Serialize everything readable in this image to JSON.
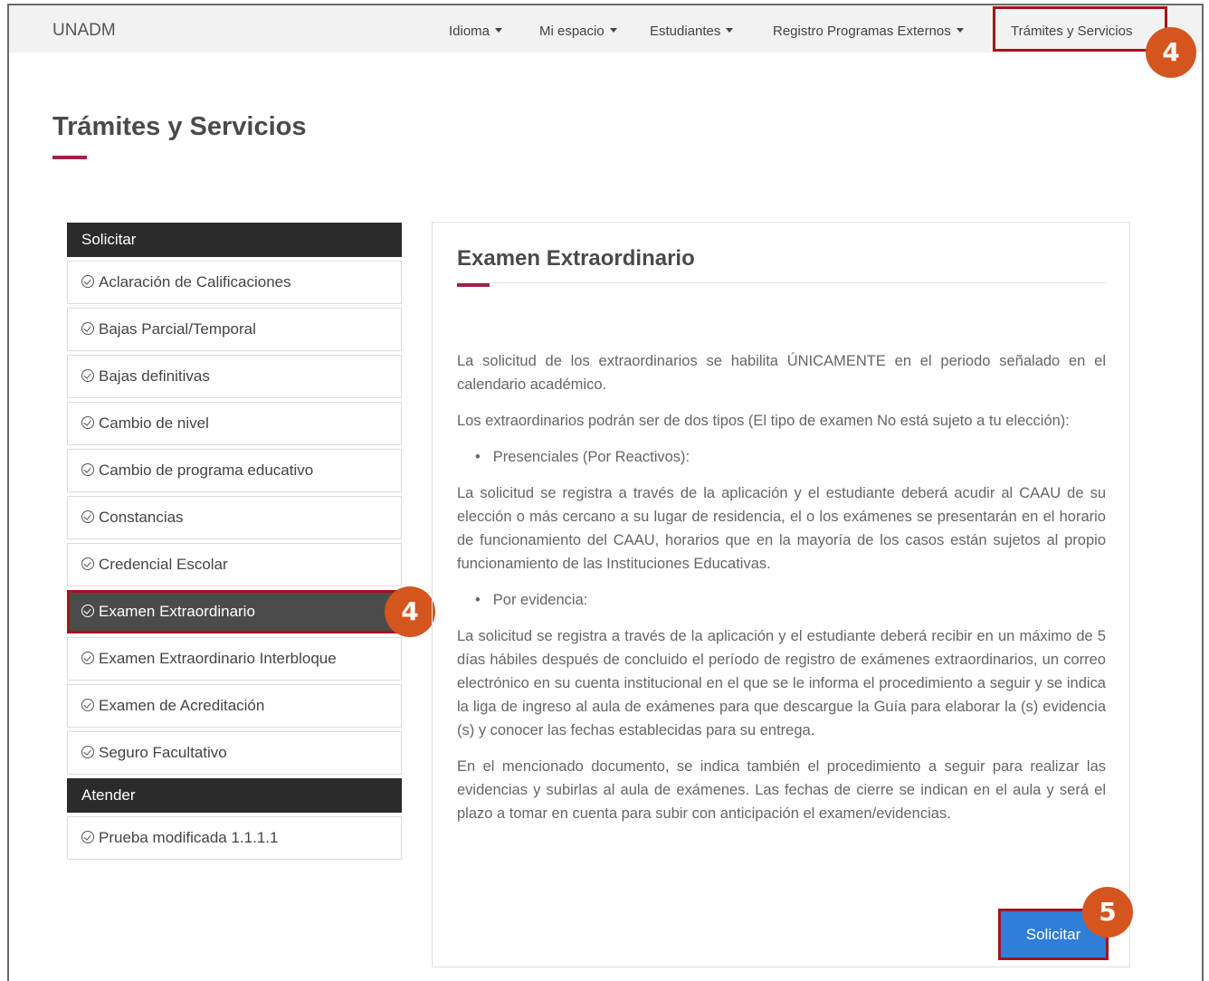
{
  "navbar": {
    "brand": "UNADM",
    "items": [
      {
        "label": "Idioma",
        "caret": true
      },
      {
        "label": "Mi espacio",
        "caret": true
      },
      {
        "label": "Estudiantes",
        "caret": true
      },
      {
        "label": "Registro Programas Externos",
        "caret": true
      },
      {
        "label": "Trámites y Servicios",
        "caret": false
      }
    ]
  },
  "annotations": {
    "nav_step": "4",
    "sidebar_step": "4",
    "button_step": "5",
    "color": "#d4551e",
    "highlight_color": "#a3151c"
  },
  "page": {
    "title": "Trámites y Servicios",
    "accent_color": "#9d2449"
  },
  "sidebar": {
    "section1": "Solicitar",
    "items": [
      {
        "label": "Aclaración de Calificaciones",
        "icon": "check-circle-icon"
      },
      {
        "label": "Bajas Parcial/Temporal",
        "icon": "check-circle-icon"
      },
      {
        "label": "Bajas definitivas",
        "icon": "check-circle-icon"
      },
      {
        "label": "Cambio de nivel",
        "icon": "check-circle-icon"
      },
      {
        "label": "Cambio de programa educativo",
        "icon": "check-circle-icon"
      },
      {
        "label": "Constancias",
        "icon": "check-circle-icon"
      },
      {
        "label": "Credencial Escolar",
        "icon": "check-circle-icon"
      },
      {
        "label": "Examen Extraordinario",
        "icon": "check-circle-icon",
        "active": true
      },
      {
        "label": "Examen Extraordinario Interbloque",
        "icon": "check-circle-icon"
      },
      {
        "label": "Examen de Acreditación",
        "icon": "check-circle-icon"
      },
      {
        "label": "Seguro Facultativo",
        "icon": "check-circle-icon"
      }
    ],
    "section2": "Atender",
    "items2": [
      {
        "label": "Prueba modificada 1.1.1.1",
        "icon": "check-circle-icon"
      }
    ]
  },
  "panel": {
    "title": "Examen Extraordinario",
    "p1": "La solicitud de los extraordinarios se habilita ÚNICAMENTE en el periodo señalado en el calendario académico.",
    "p2": "Los extraordinarios podrán ser de dos tipos (El tipo de examen No está sujeto a tu elección):",
    "bullet1": "Presenciales (Por Reactivos):",
    "p3": "La solicitud se registra a través de la aplicación y el estudiante deberá acudir al CAAU de su elección o más cercano a su lugar de residencia, el o los exámenes se presentarán en el horario de funcionamiento del CAAU, horarios que en la mayoría de los casos están sujetos al propio funcionamiento de las Instituciones Educativas.",
    "bullet2": "Por evidencia:",
    "p4": "La solicitud se registra a través de la aplicación y el estudiante deberá recibir en un máximo de 5 días hábiles después de concluido el período de registro de exámenes extraordinarios, un correo electrónico en su cuenta institucional en el que se le informa el procedimiento a seguir y se indica la liga de ingreso al aula de exámenes para que descargue la Guía para elaborar la (s) evidencia (s) y conocer las fechas establecidas para su entrega.",
    "p5": "En el mencionado documento, se indica también el procedimiento a seguir para realizar las evidencias y subirlas al aula de exámenes. Las fechas de cierre se indican en el aula y será el plazo a tomar en cuenta para subir con anticipación el examen/evidencias.",
    "button": "Solicitar"
  }
}
